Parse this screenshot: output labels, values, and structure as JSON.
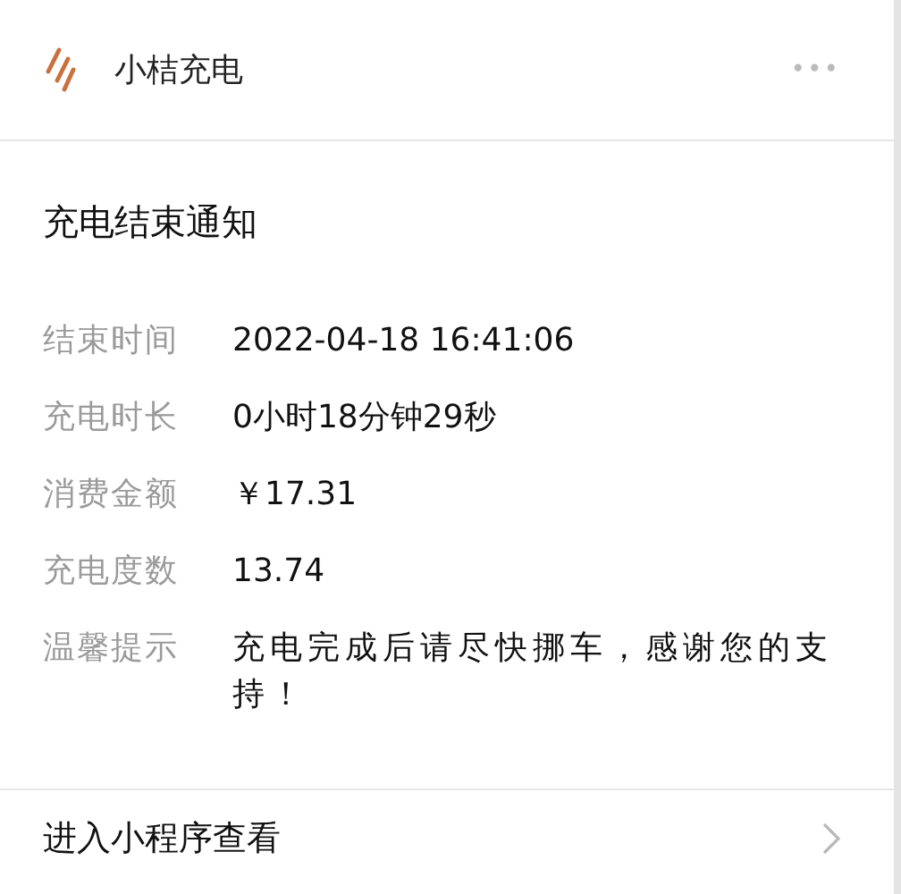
{
  "header": {
    "app_name": "小桔充电",
    "more": "•••"
  },
  "card": {
    "title": "充电结束通知",
    "fields": [
      {
        "label": "结束时间",
        "value": "2022-04-18 16:41:06"
      },
      {
        "label": "充电时长",
        "value": "0小时18分钟29秒"
      },
      {
        "label": "消费金额",
        "value": "￥17.31"
      },
      {
        "label": "充电度数",
        "value": "13.74"
      },
      {
        "label": "温馨提示",
        "value": "充电完成后请尽快挪车，感谢您的支持！"
      }
    ]
  },
  "footer": {
    "link": "进入小程序查看"
  }
}
